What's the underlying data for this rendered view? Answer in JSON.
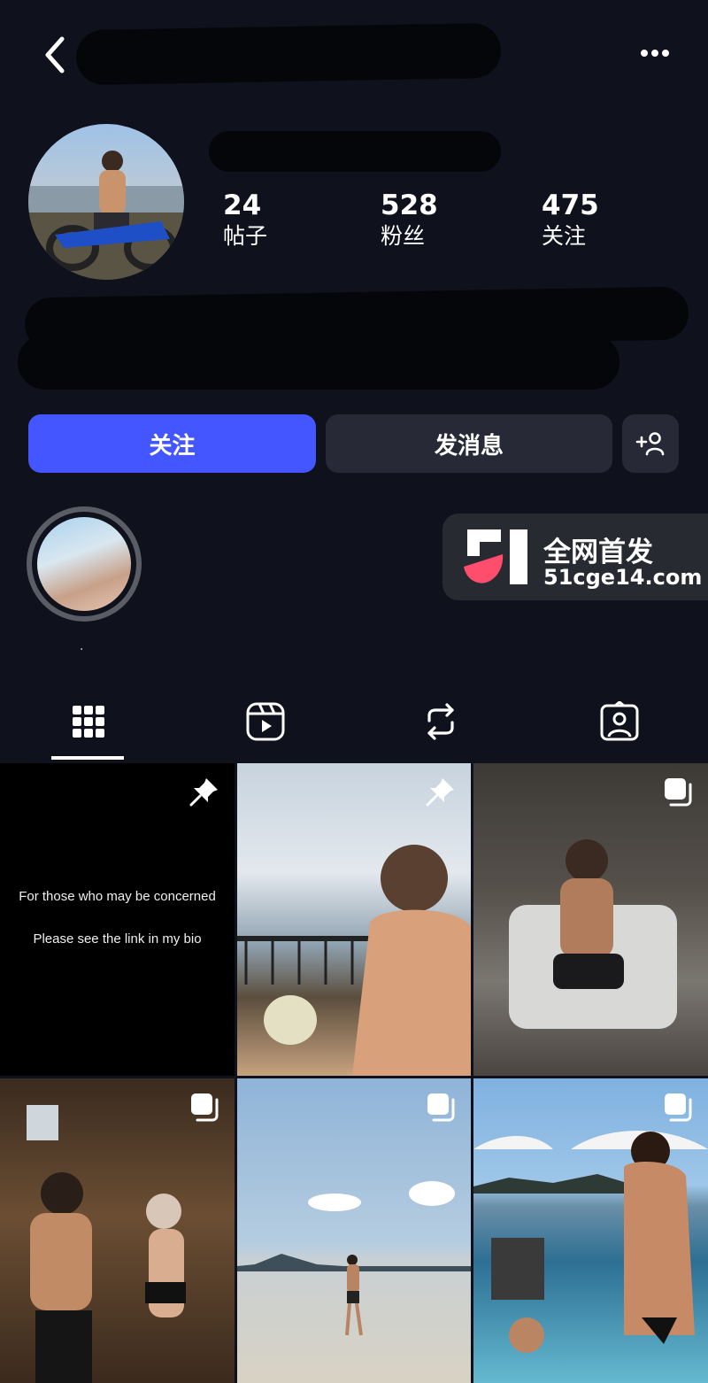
{
  "header": {
    "back_icon": "chevron-left-icon",
    "more_icon": "more-horizontal-icon"
  },
  "profile": {
    "stats": [
      {
        "value": "24",
        "label": "帖子"
      },
      {
        "value": "528",
        "label": "粉丝"
      },
      {
        "value": "475",
        "label": "关注"
      }
    ]
  },
  "actions": {
    "follow_label": "关注",
    "message_label": "发消息",
    "add_user_icon": "person-add-icon"
  },
  "watermark": {
    "title": "全网首发",
    "url": "51cge14.com"
  },
  "highlights": [
    {
      "label": "."
    }
  ],
  "tabs": [
    {
      "icon": "grid-icon",
      "selected": true
    },
    {
      "icon": "reels-icon",
      "selected": false
    },
    {
      "icon": "reposts-icon",
      "selected": false
    },
    {
      "icon": "tagged-icon",
      "selected": false
    }
  ],
  "posts": {
    "first": {
      "line1": "For those who may be concerned",
      "line2": "Please see the link in my bio",
      "badge": "pin-icon"
    },
    "second_badge": "pin-icon",
    "multi_badge": "carousel-icon"
  },
  "colors": {
    "background": "#0f111c",
    "follow_button": "#4356ff",
    "secondary_button": "#272a36",
    "watermark_logo_pink": "#ff4d6d"
  }
}
